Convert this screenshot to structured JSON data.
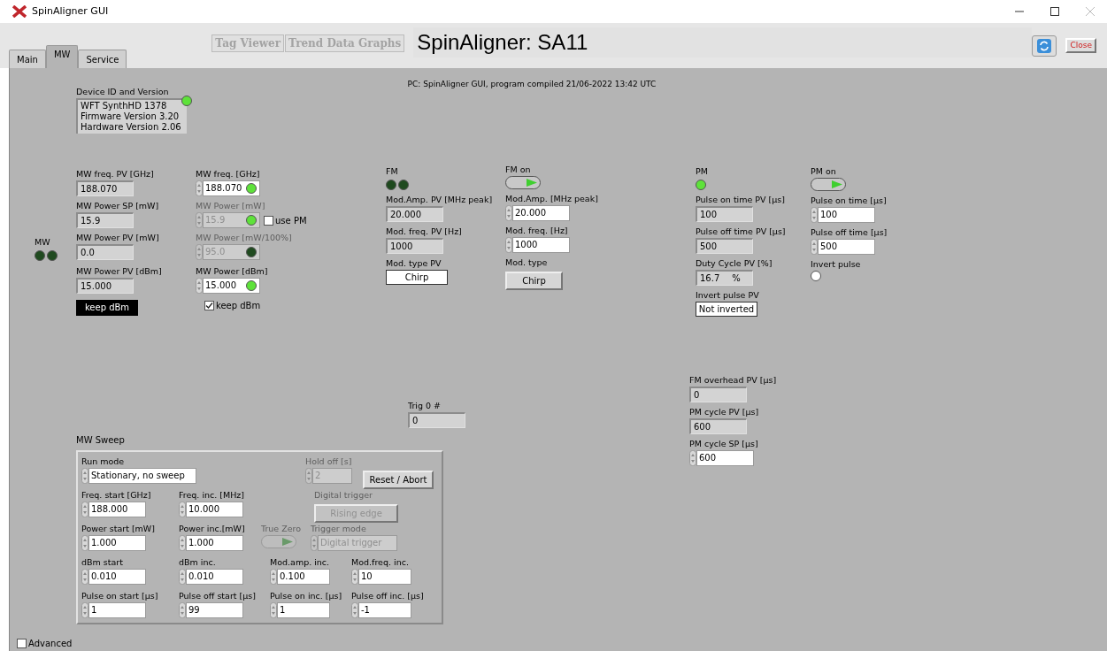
{
  "window": {
    "title": "SpinAligner GUI"
  },
  "tabs": [
    {
      "label": "Main",
      "selected": false
    },
    {
      "label": "MW",
      "selected": true
    },
    {
      "label": "Service",
      "selected": false
    }
  ],
  "header_buttons": [
    {
      "label": "Tag Viewer",
      "disabled": true
    },
    {
      "label": "Trend Data Graphs",
      "disabled": true
    }
  ],
  "app_title": "SpinAligner: SA11",
  "close_button": "Close",
  "compile_info": "PC: SpinAligner GUI, program compiled 21/06-2022 13:42 UTC",
  "device": {
    "label": "Device ID and Version",
    "lines": [
      "WFT SynthHD 1378",
      "Firmware Version 3.20",
      "Hardware Version 2.06"
    ],
    "led_on": true
  },
  "groups": [
    {
      "items": [
        {
          "kind": "leds",
          "label": "MW",
          "leds": [
            false,
            false
          ]
        }
      ]
    },
    {
      "items": [
        {
          "kind": "indicator",
          "label": "MW freq. PV [GHz]",
          "value": "188.070"
        },
        {
          "kind": "indicator",
          "label": "MW Power SP [mW]",
          "value": "15.9"
        },
        {
          "kind": "indicator",
          "label": "MW Power PV [mW]",
          "value": "0.0"
        }
      ]
    },
    {
      "items": [
        {
          "kind": "indicator",
          "label": "MW Power PV [dBm]",
          "value": "15.000"
        },
        {
          "kind": "tag",
          "value": "keep dBm"
        }
      ]
    },
    {
      "items": [
        {
          "kind": "control",
          "label": "MW freq. [GHz]",
          "value": "188.070",
          "disabled": false,
          "led_on": true
        },
        {
          "kind": "control",
          "label": "MW Power [mW]",
          "value": "15.9",
          "disabled": true,
          "led_on": true,
          "checkbox": {
            "label": "use PM",
            "checked": false
          }
        },
        {
          "kind": "control",
          "label": "MW Power [mW/100%]",
          "value": "95.0",
          "disabled": true,
          "led_on": false
        }
      ]
    },
    {
      "items": [
        {
          "kind": "control",
          "label": "MW Power [dBm]",
          "value": "15.000",
          "disabled": false,
          "led_on": true
        },
        {
          "kind": "checkbox",
          "label": "keep dBm",
          "checked": true
        }
      ]
    },
    {
      "items": [
        {
          "kind": "leds",
          "label": "FM",
          "leds": [
            false,
            false
          ]
        },
        {
          "kind": "indicator",
          "label": "Mod.Amp. PV [MHz peak]",
          "value": "20.000"
        },
        {
          "kind": "indicator",
          "label": "Mod. freq. PV [Hz]",
          "value": "1000"
        },
        {
          "kind": "text",
          "label": "Mod. type PV",
          "value": "Chirp"
        }
      ]
    },
    {
      "items": [
        {
          "kind": "toggle",
          "label": "FM on",
          "on": true,
          "disabled": false
        },
        {
          "kind": "control",
          "label": "Mod.Amp. [MHz peak]",
          "value": "20.000",
          "disabled": false
        },
        {
          "kind": "control",
          "label": "Mod. freq. [Hz]",
          "value": "1000",
          "disabled": false
        },
        {
          "kind": "button",
          "label": "Mod. type",
          "value": "Chirp",
          "disabled": false
        }
      ]
    },
    {
      "items": [
        {
          "kind": "leds",
          "label": "PM",
          "leds": [
            true
          ]
        },
        {
          "kind": "indicator",
          "label": "Pulse on time PV [µs]",
          "value": "100"
        },
        {
          "kind": "indicator",
          "label": "Pulse off time PV [µs]",
          "value": "500"
        },
        {
          "kind": "indicator",
          "label": "Duty Cycle PV [%]",
          "value": "16.7",
          "unit": "%"
        },
        {
          "kind": "text",
          "label": "Invert pulse PV",
          "value": "Not inverted"
        }
      ]
    },
    {
      "items": [
        {
          "kind": "toggle",
          "label": "PM on",
          "on": true,
          "disabled": false
        },
        {
          "kind": "control",
          "label": "Pulse on time [µs]",
          "value": "100",
          "disabled": false
        },
        {
          "kind": "control",
          "label": "Pulse off time [µs]",
          "value": "500",
          "disabled": false
        },
        {
          "kind": "radio",
          "label": "Invert pulse",
          "checked": false
        }
      ]
    },
    {
      "items": [
        {
          "kind": "indicator",
          "label": "FM overhead PV [µs]",
          "value": "0"
        },
        {
          "kind": "indicator",
          "label": "PM cycle PV [µs]",
          "value": "600"
        },
        {
          "kind": "control",
          "label": "PM cycle SP [µs]",
          "value": "600",
          "disabled": false
        }
      ]
    },
    {
      "items": [
        {
          "kind": "indicator",
          "label": "Trig 0 #",
          "value": "0"
        }
      ]
    }
  ],
  "sweep": {
    "title": "MW Sweep",
    "rows": [
      [
        {
          "kind": "control",
          "label": "Run mode",
          "value": "Stationary, no sweep",
          "disabled": false
        },
        {
          "kind": "control",
          "label": "Hold off [s]",
          "value": "2",
          "disabled": true
        },
        {
          "kind": "button",
          "value": "Reset / Abort",
          "disabled": false
        }
      ],
      [
        {
          "kind": "control",
          "label": "Freq. start [GHz]",
          "value": "188.000",
          "disabled": false
        },
        {
          "kind": "control",
          "label": "Freq. inc. [MHz]",
          "value": "10.000",
          "disabled": false
        },
        {
          "kind": "button",
          "label": "Digital trigger",
          "value": "Rising edge",
          "disabled": true
        }
      ],
      [
        {
          "kind": "control",
          "label": "Power start [mW]",
          "value": "1.000",
          "disabled": false
        },
        {
          "kind": "control",
          "label": "Power inc.[mW]",
          "value": "1.000",
          "disabled": false
        },
        {
          "kind": "toggle",
          "label": "True Zero",
          "on": true,
          "disabled": true
        },
        {
          "kind": "control",
          "label": "Trigger mode",
          "value": "Digital trigger",
          "disabled": true
        }
      ],
      [
        {
          "kind": "control",
          "label": "dBm start",
          "value": "0.010",
          "disabled": false
        },
        {
          "kind": "control",
          "label": "dBm inc.",
          "value": "0.010",
          "disabled": false
        },
        {
          "kind": "control",
          "label": "Mod.amp. inc.",
          "value": "0.100",
          "disabled": false
        },
        {
          "kind": "control",
          "label": "Mod.freq. inc.",
          "value": "10",
          "disabled": false
        }
      ],
      [
        {
          "kind": "control",
          "label": "Pulse on start [µs]",
          "value": "1",
          "disabled": false
        },
        {
          "kind": "control",
          "label": "Pulse off start [µs]",
          "value": "99",
          "disabled": false
        },
        {
          "kind": "control",
          "label": "Pulse on inc. [µs]",
          "value": "1",
          "disabled": false
        },
        {
          "kind": "control",
          "label": "Pulse off inc. [µs]",
          "value": "-1",
          "disabled": false
        }
      ]
    ]
  },
  "advanced": {
    "label": "Advanced",
    "checked": false
  }
}
